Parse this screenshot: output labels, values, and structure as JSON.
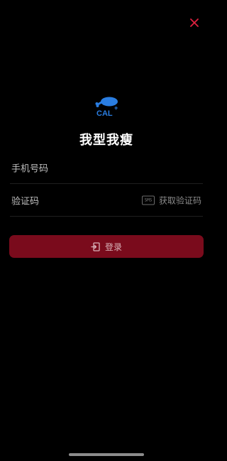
{
  "close_icon": "close-icon",
  "brand": {
    "logo_text": "CAL",
    "logo_plus": "+",
    "logo_color": "#2a7de1",
    "app_name": "我型我瘦"
  },
  "form": {
    "phone_placeholder": "手机号码",
    "code_placeholder": "验证码",
    "get_code_label": "获取验证码",
    "sms_icon_text": "SMS"
  },
  "login": {
    "label": "登录",
    "color": "#7a0b1c"
  },
  "colors": {
    "background": "#000000",
    "accent": "#e0213f"
  }
}
